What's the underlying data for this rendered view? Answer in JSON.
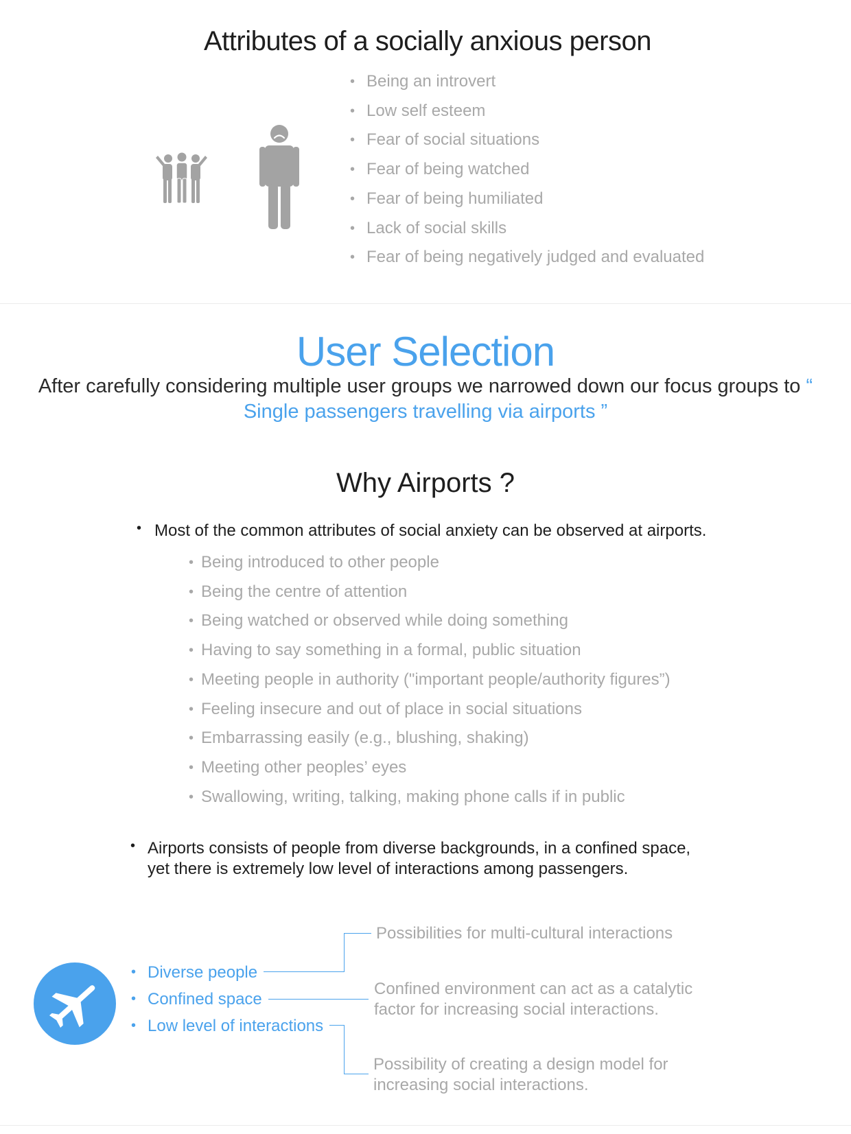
{
  "section1": {
    "title": "Attributes of a socially anxious person",
    "attributes": [
      "Being an introvert",
      "Low self esteem",
      "Fear of social situations",
      "Fear of being watched",
      "Fear of being humiliated",
      "Lack of social skills",
      "Fear of being negatively judged and evaluated"
    ],
    "icons": [
      "group-people-icon",
      "sad-person-icon"
    ]
  },
  "section2": {
    "title": "User Selection",
    "intro": "After carefully considering multiple user groups we narrowed down our focus groups to",
    "open_quote": "“",
    "focus": "Single passengers travelling via airports ”"
  },
  "section3": {
    "title": "Why Airports ?",
    "point1": "Most of the common attributes of social anxiety can be observed at airports.",
    "observations": [
      "Being introduced to other people",
      "Being the centre of attention",
      "Being watched or observed while doing something",
      "Having to say something in a formal, public situation",
      "Meeting people in authority (\"important people/authority figures”)",
      "Feeling insecure and out of place in social situations",
      "Embarrassing easily (e.g., blushing, shaking)",
      "Meeting other peoples’ eyes",
      "Swallowing, writing, talking, making phone calls if in public"
    ],
    "point2_line1": "Airports consists of people from diverse backgrounds, in a confined space,",
    "point2_line2": "yet there is extremely low level of interactions among passengers."
  },
  "diagram": {
    "icon": "airplane-icon",
    "accent": "#4aa2ec",
    "factors": [
      "Diverse people",
      "Confined space",
      "Low level of interactions"
    ],
    "outcomes": {
      "first": "Possibilities for multi-cultural interactions",
      "second_line1": "Confined environment can act as a catalytic",
      "second_line2": "factor for increasing social interactions.",
      "third_line1": "Possibility of creating a design model for",
      "third_line2": "increasing social interactions."
    }
  }
}
